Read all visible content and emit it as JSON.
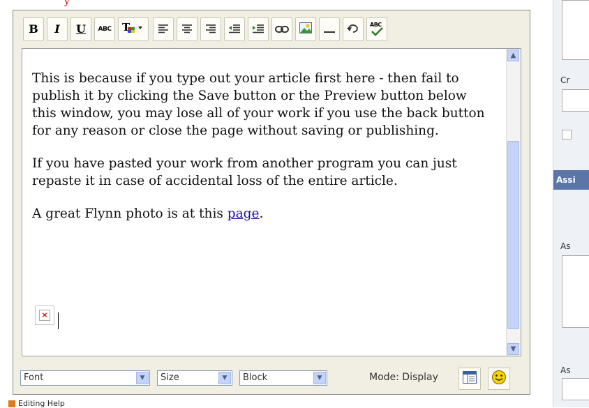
{
  "toolbar": {
    "bold": "B",
    "italic": "I",
    "underline": "U",
    "strike": "ABC",
    "spell": "ABC"
  },
  "content": {
    "para1": "This is because if you type out your article first here - then fail to publish it by clicking the Save button or the Preview button below this window, you may lose all of your work if you use the back button for any reason or close the page without saving or publishing.",
    "para2": "If you have pasted your work from another program you can just repaste it in case of accidental loss of the entire article.",
    "para3_prefix": "A great Flynn photo is at this ",
    "para3_link": "page",
    "para3_suffix": "."
  },
  "bottom": {
    "font": "Font",
    "size": "Size",
    "block": "Block",
    "mode": "Mode: Display"
  },
  "footer": {
    "label": "Editing Help"
  },
  "right_panel": {
    "label_cr": "Cr",
    "header": "Assi",
    "label_as1": "As",
    "label_as2": "As"
  }
}
